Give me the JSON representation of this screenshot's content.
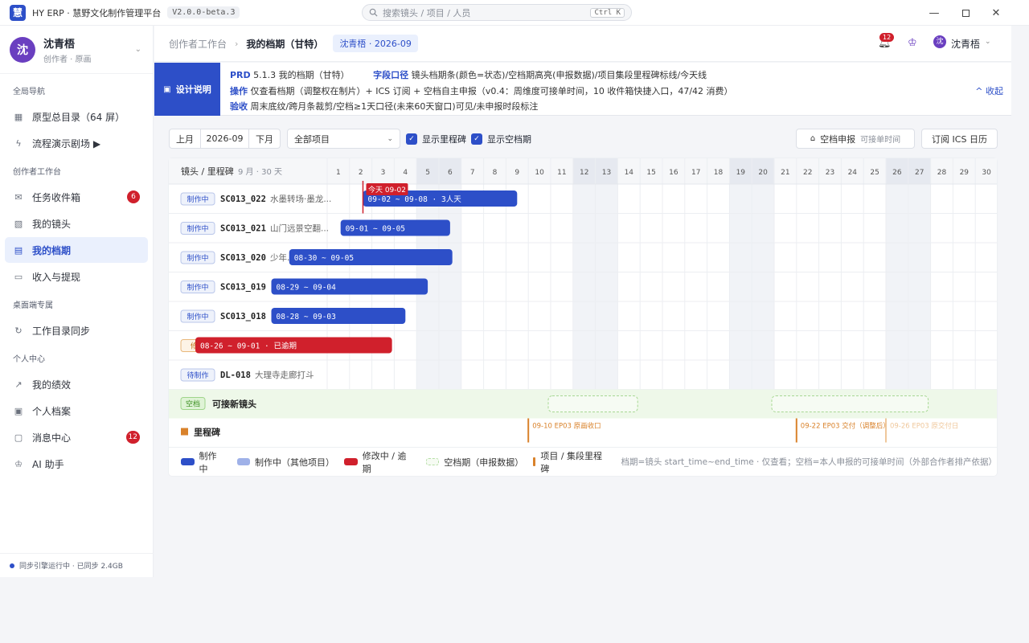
{
  "titlebar": {
    "app_title": "HY ERP · 慧野文化制作管理平台",
    "version": "V2.0.0-beta.3",
    "search_placeholder": "搜索镜头 / 项目 / 人员",
    "search_shortcut": "Ctrl K",
    "logo_text": "慧"
  },
  "sidebar": {
    "user": {
      "name": "沈青梧",
      "role": "创作者 · 原画",
      "avatar_text": "沈"
    },
    "sections": [
      {
        "title": "全局导航",
        "items": [
          {
            "label": "原型总目录（64 屏）",
            "icon": "grid-icon"
          },
          {
            "label": "流程演示剧场 ▶",
            "icon": "lightning-icon"
          }
        ]
      },
      {
        "title": "创作者工作台",
        "items": [
          {
            "label": "任务收件箱",
            "icon": "inbox-icon",
            "badge": "6"
          },
          {
            "label": "我的镜头",
            "icon": "image-icon"
          },
          {
            "label": "我的档期",
            "icon": "calendar-icon",
            "active": true
          },
          {
            "label": "收入与提现",
            "icon": "wallet-icon"
          }
        ]
      },
      {
        "title": "桌面端专属",
        "items": [
          {
            "label": "工作目录同步",
            "icon": "sync-icon"
          }
        ]
      },
      {
        "title": "个人中心",
        "items": [
          {
            "label": "我的绩效",
            "icon": "chart-icon"
          },
          {
            "label": "个人档案",
            "icon": "profile-icon"
          },
          {
            "label": "消息中心",
            "icon": "message-icon",
            "badge": "12"
          },
          {
            "label": "AI 助手",
            "icon": "robot-icon"
          }
        ]
      }
    ],
    "sync_status": "同步引擎运行中 · 已同步 2.4GB"
  },
  "topbar": {
    "crumb_parent": "创作者工作台",
    "crumb_current": "我的档期（甘特）",
    "context_tag": "沈青梧 · 2026-09",
    "bell_count": "12",
    "user_name": "沈青梧",
    "avatar_text": "沈"
  },
  "design_note": {
    "label": "设计说明",
    "line1": {
      "k1": "PRD",
      "v1": "5.1.3 我的档期（甘特）",
      "k2": "字段口径",
      "v2": "镜头档期条(颜色=状态)/空档期高亮(申报数据)/项目集段里程碑标线/今天线"
    },
    "line2": {
      "k": "操作",
      "v": "仅查看档期（调整权在制片）+ ICS 订阅 + 空档自主申报（v0.4：周维度可接单时间，10 收件箱快捷入口，47/42 消费）"
    },
    "line3": {
      "k": "验收",
      "v": "周末底纹/跨月条裁剪/空档≥1天口径(未来60天窗口)可见/未申报时段标注"
    },
    "collapse": "收起"
  },
  "controls": {
    "prev_month": "上月",
    "month": "2026-09",
    "next_month": "下月",
    "project_select": "全部项目",
    "show_milestones": "显示里程碑",
    "show_free": "显示空档期",
    "free_report": "空档申报",
    "free_report_hint": "可接单时间",
    "subscribe": "订阅 ICS 日历"
  },
  "gantt": {
    "header_label": "镜头 / 里程碑",
    "header_sub": "9 月 · 30 天",
    "days": [
      "1",
      "2",
      "3",
      "4",
      "5",
      "6",
      "7",
      "8",
      "9",
      "10",
      "11",
      "12",
      "13",
      "14",
      "15",
      "16",
      "17",
      "18",
      "19",
      "20",
      "21",
      "22",
      "23",
      "24",
      "25",
      "26",
      "27",
      "28",
      "29",
      "30"
    ],
    "weekends": [
      5,
      6,
      12,
      13,
      19,
      20,
      26,
      27
    ],
    "today_label": "今天 09-02",
    "today_day": 2.6,
    "rows": [
      {
        "status": "制作中",
        "code": "SC013_022",
        "title": "水墨转场·墨龙...",
        "bar_text": "09-02 ~ 09-08 · 3人天",
        "start": 2.6,
        "end": 9.5,
        "kind": "blue"
      },
      {
        "status": "制作中",
        "code": "SC013_021",
        "title": "山门远景空翻...",
        "bar_text": "09-01 ~ 09-05",
        "start": 1.6,
        "end": 6.5,
        "kind": "blue"
      },
      {
        "status": "制作中",
        "code": "SC013_020",
        "title": "少年...",
        "bar_text": "08-30 ~ 09-05",
        "start": -0.7,
        "end": 6.6,
        "kind": "blue"
      },
      {
        "status": "制作中",
        "code": "SC013_019",
        "title": "",
        "bar_text": "08-29 ~ 09-04",
        "start": -1.5,
        "end": 5.5,
        "kind": "blue"
      },
      {
        "status": "制作中",
        "code": "SC013_018",
        "title": "",
        "bar_text": "08-28 ~ 09-03",
        "start": -1.5,
        "end": 4.5,
        "kind": "blue"
      },
      {
        "status": "修改",
        "code": "",
        "title": "",
        "bar_text": "08-26 ~ 09-01 · 已逾期",
        "start": -4.9,
        "end": 3.9,
        "kind": "red"
      },
      {
        "status": "待制作",
        "code": "DL-018",
        "title": "大理寺走廊打斗",
        "bar_text": "",
        "start": 0,
        "end": 0,
        "kind": "none"
      }
    ],
    "free_row": {
      "tag": "空档",
      "label": "可接新镜头",
      "ranges": [
        [
          11,
          14
        ],
        [
          21,
          27
        ]
      ]
    },
    "milestone_row": {
      "label": "里程碑",
      "items": [
        {
          "day": 10,
          "text": "09-10 EP03 原画收口",
          "faded": false
        },
        {
          "day": 22,
          "text": "09-22 EP03 交付（调整后）",
          "faded": false
        },
        {
          "day": 26,
          "text": "09-26 EP03 原交付日",
          "faded": true
        }
      ]
    }
  },
  "legend": {
    "items": [
      {
        "label": "制作中",
        "color": "#2d4fc8",
        "type": "solid"
      },
      {
        "label": "制作中（其他项目）",
        "color": "#9fb1e8",
        "type": "solid"
      },
      {
        "label": "修改中 / 逾期",
        "color": "#d0202c",
        "type": "solid"
      },
      {
        "label": "空档期（申报数据）",
        "color": "#b7dfa8",
        "type": "dashed"
      },
      {
        "label": "项目 / 集段里程碑",
        "color": "#d9822b",
        "type": "line"
      }
    ],
    "note": "档期=镜头 start_time~end_time · 仅查看；空档=本人申报的可接单时间（外部合作者排产依据）"
  },
  "colors": {
    "accent": "#2d4fc8",
    "danger": "#d0202c",
    "milestone": "#d9822b",
    "free": "#eef8e9"
  }
}
